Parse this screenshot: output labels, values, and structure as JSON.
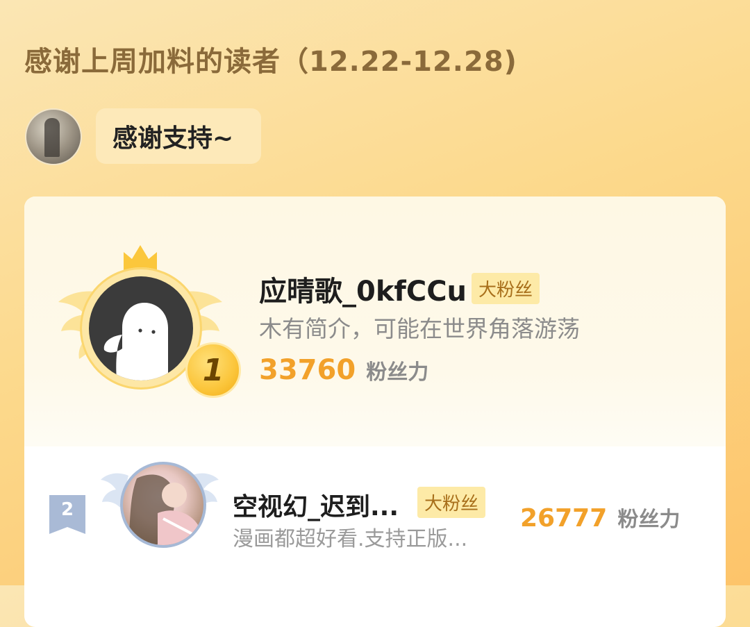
{
  "header": {
    "title": "感谢上周加料的读者（12.22-12.28)"
  },
  "author": {
    "message": "感谢支持~"
  },
  "ranking": [
    {
      "rank": "1",
      "name": "应晴歌_0kfCCu",
      "badge": "大粉丝",
      "description": "木有简介，可能在世界角落游荡",
      "power_value": "33760",
      "power_unit": "粉丝力"
    },
    {
      "rank": "2",
      "name": "空视幻_迟到...",
      "badge": "大粉丝",
      "description": "漫画都超好看.支持正版...",
      "power_value": "26777",
      "power_unit": "粉丝力"
    }
  ],
  "colors": {
    "accent_orange": "#f2a12a",
    "badge_bg": "#fdeaa7",
    "badge_text": "#a86f1b",
    "title_brown": "#8a6a3a"
  }
}
